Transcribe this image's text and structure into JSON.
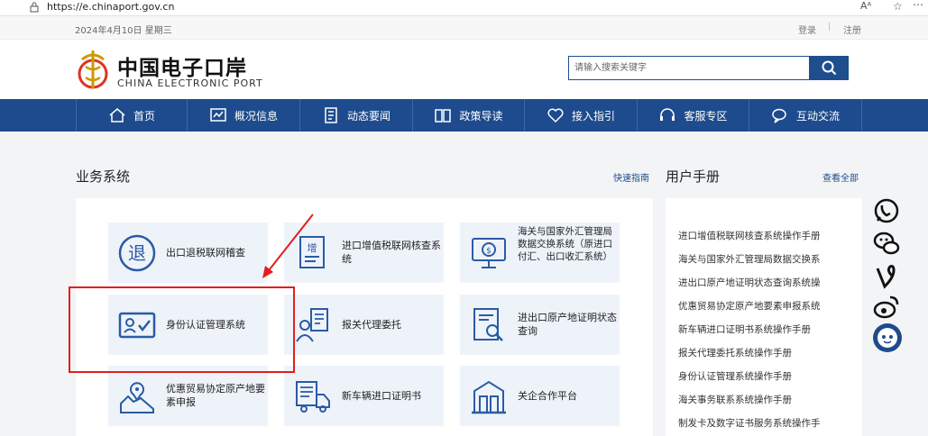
{
  "browser": {
    "url": "https://e.chinaport.gov.cn",
    "reader_label": "Aᴬ",
    "fav_icon": "star-icon",
    "more_icon": "more-icon"
  },
  "topbar": {
    "date": "2024年4月10日 星期三",
    "login": "登录",
    "separator": "|",
    "register": "注册"
  },
  "header": {
    "title_cn": "中国电子口岸",
    "title_en": "CHINA ELECTRONIC PORT",
    "search_placeholder": "请输入搜索关键字"
  },
  "nav": {
    "items": [
      {
        "label": "首页",
        "icon": "home-icon"
      },
      {
        "label": "概况信息",
        "icon": "chart-icon"
      },
      {
        "label": "动态要闻",
        "icon": "news-icon"
      },
      {
        "label": "政策导读",
        "icon": "book-icon"
      },
      {
        "label": "接入指引",
        "icon": "heart-icon"
      },
      {
        "label": "客服专区",
        "icon": "headset-icon"
      },
      {
        "label": "互动交流",
        "icon": "chat-icon"
      }
    ]
  },
  "biz": {
    "title": "业务系统",
    "link": "快速指南",
    "cards": [
      {
        "label": "出口退税联网稽查",
        "icon": "tax-refund-icon"
      },
      {
        "label": "进口增值税联网核查系统",
        "icon": "vat-doc-icon"
      },
      {
        "label": "海关与国家外汇管理局数据交换系统（原进口付汇、出口收汇系统）",
        "icon": "monitor-exchange-icon"
      },
      {
        "label": "身份认证管理系统",
        "icon": "id-card-icon"
      },
      {
        "label": "报关代理委托",
        "icon": "agent-icon"
      },
      {
        "label": "进出口原产地证明状态查询",
        "icon": "doc-search-icon"
      },
      {
        "label": "优惠贸易协定原产地要素申报",
        "icon": "map-pin-icon"
      },
      {
        "label": "新车辆进口证明书",
        "icon": "truck-icon"
      },
      {
        "label": "关企合作平台",
        "icon": "building-icon"
      }
    ]
  },
  "manual": {
    "title": "用户手册",
    "link": "查看全部",
    "items": [
      "进口增值税联网核查系统操作手册",
      "海关与国家外汇管理局数据交换系",
      "进出口原产地证明状态查询系统操",
      "优惠贸易协定原产地要素申报系统",
      "新车辆进口证明书系统操作手册",
      "报关代理委托系统操作手册",
      "身份认证管理系统操作手册",
      "海关事务联系系统操作手册",
      "制发卡及数字证书服务系统操作手"
    ]
  },
  "floats": [
    "wechat-phone-icon",
    "wechat-icon",
    "vine-icon",
    "weibo-icon",
    "robot-icon"
  ],
  "colors": {
    "nav_bg": "#1d4b8d",
    "card_bg": "#eef3fa",
    "annotation": "#e21e1e"
  }
}
